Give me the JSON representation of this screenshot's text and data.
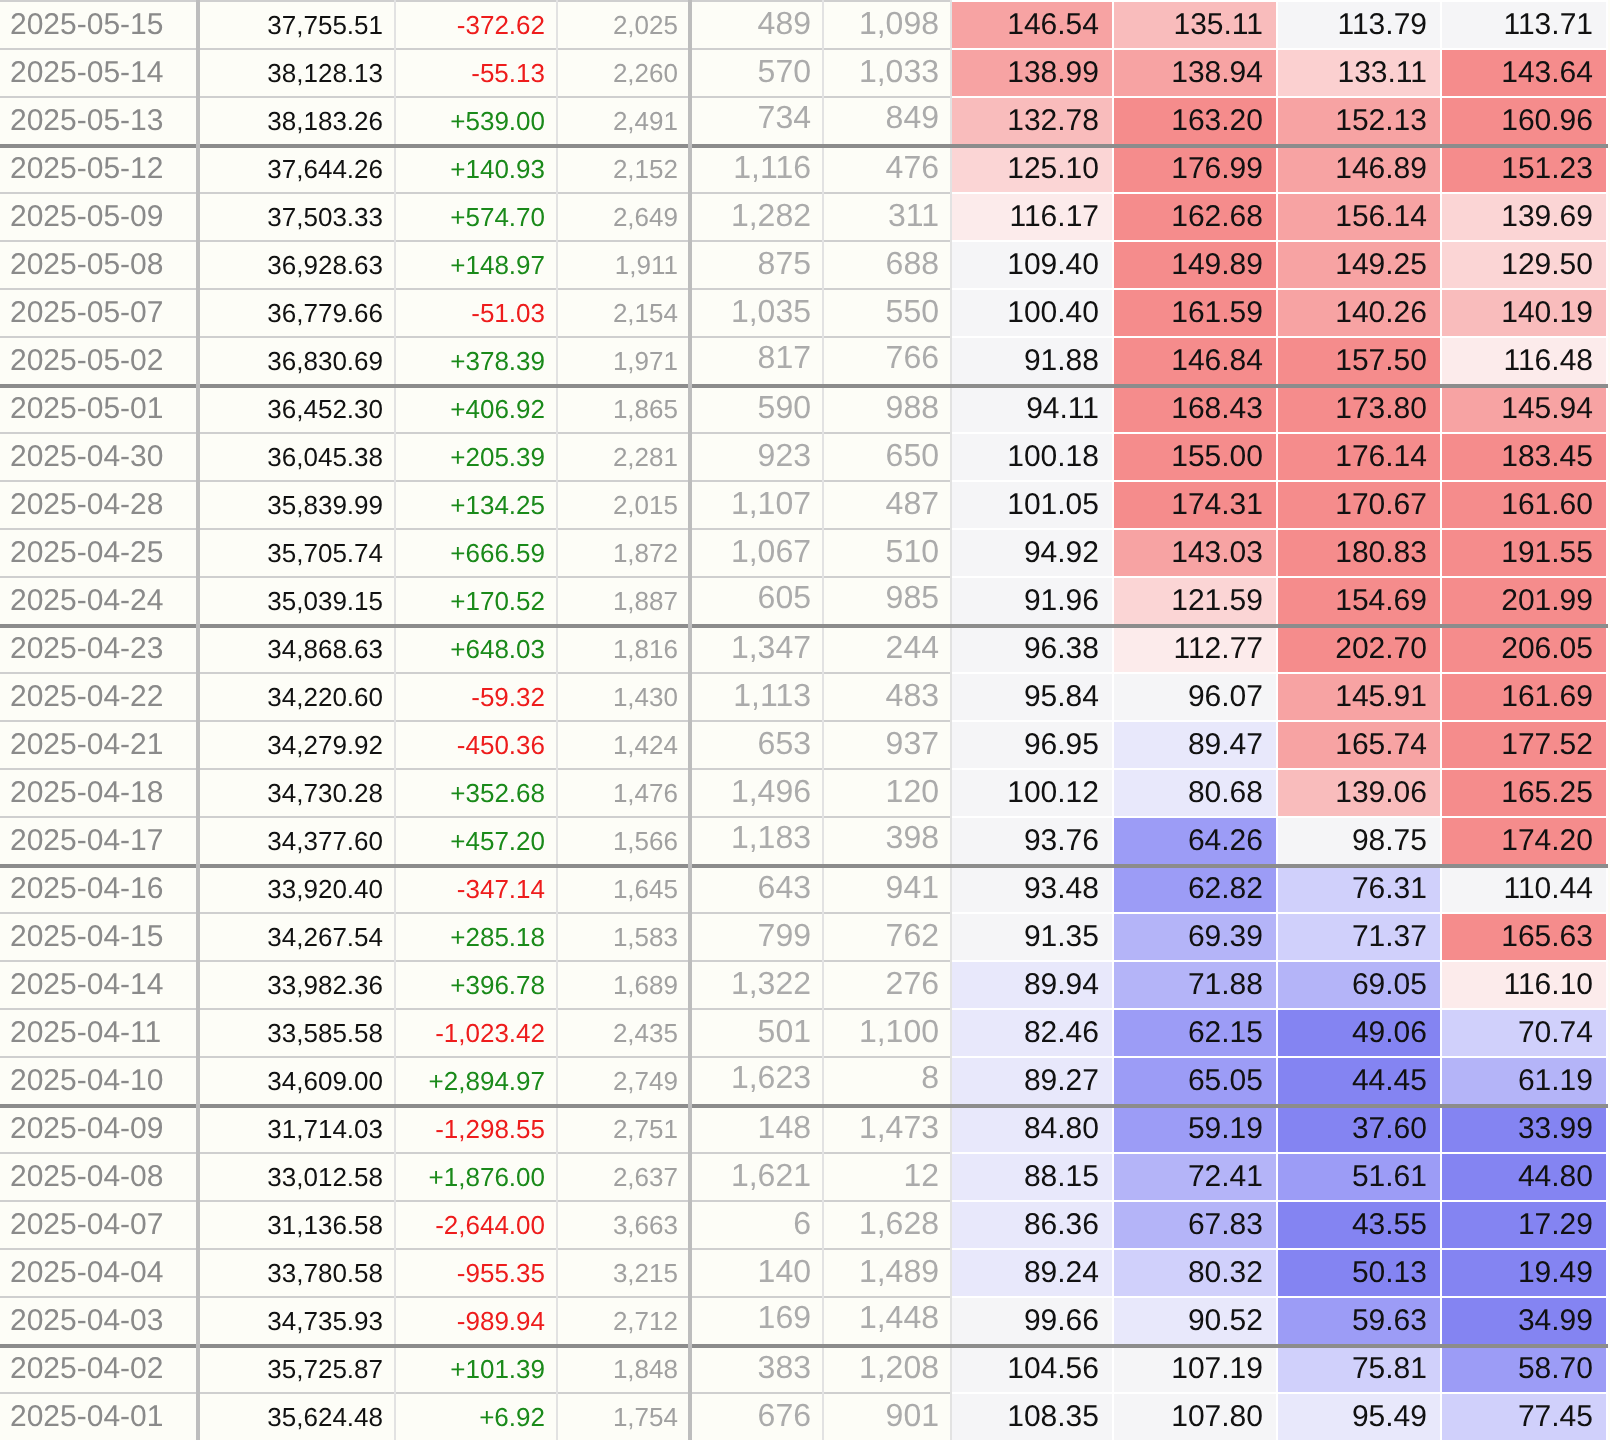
{
  "rows": [
    {
      "group_start": false,
      "date": "2025-05-15",
      "close": "37,755.51",
      "change": "-372.62",
      "negative": true,
      "column_4": "2,025",
      "column_5": "489",
      "column_6": "1,098",
      "heat": [
        {
          "value": "146.54",
          "color": "#f7a3a3"
        },
        {
          "value": "135.11",
          "color": "#f9bcbc"
        },
        {
          "value": "113.79",
          "color": "#f5f5f7"
        },
        {
          "value": "113.71",
          "color": "#f5f5f7"
        }
      ]
    },
    {
      "group_start": false,
      "date": "2025-05-14",
      "close": "38,128.13",
      "change": "-55.13",
      "negative": true,
      "column_4": "2,260",
      "column_5": "570",
      "column_6": "1,033",
      "heat": [
        {
          "value": "138.99",
          "color": "#f7a3a3"
        },
        {
          "value": "138.94",
          "color": "#f7a3a3"
        },
        {
          "value": "133.11",
          "color": "#fbd0d0"
        },
        {
          "value": "143.64",
          "color": "#f58c8c"
        }
      ]
    },
    {
      "group_start": false,
      "date": "2025-05-13",
      "close": "38,183.26",
      "change": "+539.00",
      "negative": false,
      "column_4": "2,491",
      "column_5": "734",
      "column_6": "849",
      "heat": [
        {
          "value": "132.78",
          "color": "#f9bcbc"
        },
        {
          "value": "163.20",
          "color": "#f58c8c"
        },
        {
          "value": "152.13",
          "color": "#f7a3a3"
        },
        {
          "value": "160.96",
          "color": "#f58c8c"
        }
      ]
    },
    {
      "group_start": true,
      "date": "2025-05-12",
      "close": "37,644.26",
      "change": "+140.93",
      "negative": false,
      "column_4": "2,152",
      "column_5": "1,116",
      "column_6": "476",
      "heat": [
        {
          "value": "125.10",
          "color": "#fbd5d5"
        },
        {
          "value": "176.99",
          "color": "#f58c8c"
        },
        {
          "value": "146.89",
          "color": "#f7a3a3"
        },
        {
          "value": "151.23",
          "color": "#f58c8c"
        }
      ]
    },
    {
      "group_start": false,
      "date": "2025-05-09",
      "close": "37,503.33",
      "change": "+574.70",
      "negative": false,
      "column_4": "2,649",
      "column_5": "1,282",
      "column_6": "311",
      "heat": [
        {
          "value": "116.17",
          "color": "#fcebeb"
        },
        {
          "value": "162.68",
          "color": "#f58c8c"
        },
        {
          "value": "156.14",
          "color": "#f7a3a3"
        },
        {
          "value": "139.69",
          "color": "#fbd5d5"
        }
      ]
    },
    {
      "group_start": false,
      "date": "2025-05-08",
      "close": "36,928.63",
      "change": "+148.97",
      "negative": false,
      "column_4": "1,911",
      "column_5": "875",
      "column_6": "688",
      "heat": [
        {
          "value": "109.40",
          "color": "#f5f5f7"
        },
        {
          "value": "149.89",
          "color": "#f58c8c"
        },
        {
          "value": "149.25",
          "color": "#f7a3a3"
        },
        {
          "value": "129.50",
          "color": "#fbd5d5"
        }
      ]
    },
    {
      "group_start": false,
      "date": "2025-05-07",
      "close": "36,779.66",
      "change": "-51.03",
      "negative": true,
      "column_4": "2,154",
      "column_5": "1,035",
      "column_6": "550",
      "heat": [
        {
          "value": "100.40",
          "color": "#f5f5f7"
        },
        {
          "value": "161.59",
          "color": "#f58c8c"
        },
        {
          "value": "140.26",
          "color": "#f7a3a3"
        },
        {
          "value": "140.19",
          "color": "#f9bcbc"
        }
      ]
    },
    {
      "group_start": false,
      "date": "2025-05-02",
      "close": "36,830.69",
      "change": "+378.39",
      "negative": false,
      "column_4": "1,971",
      "column_5": "817",
      "column_6": "766",
      "heat": [
        {
          "value": "91.88",
          "color": "#f5f5f7"
        },
        {
          "value": "146.84",
          "color": "#f58c8c"
        },
        {
          "value": "157.50",
          "color": "#f58c8c"
        },
        {
          "value": "116.48",
          "color": "#fcebeb"
        }
      ]
    },
    {
      "group_start": true,
      "date": "2025-05-01",
      "close": "36,452.30",
      "change": "+406.92",
      "negative": false,
      "column_4": "1,865",
      "column_5": "590",
      "column_6": "988",
      "heat": [
        {
          "value": "94.11",
          "color": "#f5f5f7"
        },
        {
          "value": "168.43",
          "color": "#f58c8c"
        },
        {
          "value": "173.80",
          "color": "#f58c8c"
        },
        {
          "value": "145.94",
          "color": "#f7a3a3"
        }
      ]
    },
    {
      "group_start": false,
      "date": "2025-04-30",
      "close": "36,045.38",
      "change": "+205.39",
      "negative": false,
      "column_4": "2,281",
      "column_5": "923",
      "column_6": "650",
      "heat": [
        {
          "value": "100.18",
          "color": "#f5f5f7"
        },
        {
          "value": "155.00",
          "color": "#f58c8c"
        },
        {
          "value": "176.14",
          "color": "#f58c8c"
        },
        {
          "value": "183.45",
          "color": "#f58c8c"
        }
      ]
    },
    {
      "group_start": false,
      "date": "2025-04-28",
      "close": "35,839.99",
      "change": "+134.25",
      "negative": false,
      "column_4": "2,015",
      "column_5": "1,107",
      "column_6": "487",
      "heat": [
        {
          "value": "101.05",
          "color": "#f5f5f7"
        },
        {
          "value": "174.31",
          "color": "#f58c8c"
        },
        {
          "value": "170.67",
          "color": "#f58c8c"
        },
        {
          "value": "161.60",
          "color": "#f58c8c"
        }
      ]
    },
    {
      "group_start": false,
      "date": "2025-04-25",
      "close": "35,705.74",
      "change": "+666.59",
      "negative": false,
      "column_4": "1,872",
      "column_5": "1,067",
      "column_6": "510",
      "heat": [
        {
          "value": "94.92",
          "color": "#f5f5f7"
        },
        {
          "value": "143.03",
          "color": "#f7a3a3"
        },
        {
          "value": "180.83",
          "color": "#f58c8c"
        },
        {
          "value": "191.55",
          "color": "#f58c8c"
        }
      ]
    },
    {
      "group_start": false,
      "date": "2025-04-24",
      "close": "35,039.15",
      "change": "+170.52",
      "negative": false,
      "column_4": "1,887",
      "column_5": "605",
      "column_6": "985",
      "heat": [
        {
          "value": "91.96",
          "color": "#f5f5f7"
        },
        {
          "value": "121.59",
          "color": "#fbd5d5"
        },
        {
          "value": "154.69",
          "color": "#f58c8c"
        },
        {
          "value": "201.99",
          "color": "#f58c8c"
        }
      ]
    },
    {
      "group_start": true,
      "date": "2025-04-23",
      "close": "34,868.63",
      "change": "+648.03",
      "negative": false,
      "column_4": "1,816",
      "column_5": "1,347",
      "column_6": "244",
      "heat": [
        {
          "value": "96.38",
          "color": "#f5f5f7"
        },
        {
          "value": "112.77",
          "color": "#fcebeb"
        },
        {
          "value": "202.70",
          "color": "#f58c8c"
        },
        {
          "value": "206.05",
          "color": "#f58c8c"
        }
      ]
    },
    {
      "group_start": false,
      "date": "2025-04-22",
      "close": "34,220.60",
      "change": "-59.32",
      "negative": true,
      "column_4": "1,430",
      "column_5": "1,113",
      "column_6": "483",
      "heat": [
        {
          "value": "95.84",
          "color": "#f5f5f7"
        },
        {
          "value": "96.07",
          "color": "#f5f5f7"
        },
        {
          "value": "145.91",
          "color": "#f7a3a3"
        },
        {
          "value": "161.69",
          "color": "#f58c8c"
        }
      ]
    },
    {
      "group_start": false,
      "date": "2025-04-21",
      "close": "34,279.92",
      "change": "-450.36",
      "negative": true,
      "column_4": "1,424",
      "column_5": "653",
      "column_6": "937",
      "heat": [
        {
          "value": "96.95",
          "color": "#f5f5f7"
        },
        {
          "value": "89.47",
          "color": "#e8e8fb"
        },
        {
          "value": "165.74",
          "color": "#f7a3a3"
        },
        {
          "value": "177.52",
          "color": "#f58c8c"
        }
      ]
    },
    {
      "group_start": false,
      "date": "2025-04-18",
      "close": "34,730.28",
      "change": "+352.68",
      "negative": false,
      "column_4": "1,476",
      "column_5": "1,496",
      "column_6": "120",
      "heat": [
        {
          "value": "100.12",
          "color": "#f5f5f7"
        },
        {
          "value": "80.68",
          "color": "#e8e8fb"
        },
        {
          "value": "139.06",
          "color": "#f9bcbc"
        },
        {
          "value": "165.25",
          "color": "#f58c8c"
        }
      ]
    },
    {
      "group_start": false,
      "date": "2025-04-17",
      "close": "34,377.60",
      "change": "+457.20",
      "negative": false,
      "column_4": "1,566",
      "column_5": "1,183",
      "column_6": "398",
      "heat": [
        {
          "value": "93.76",
          "color": "#f5f5f7"
        },
        {
          "value": "64.26",
          "color": "#9c9cf6"
        },
        {
          "value": "98.75",
          "color": "#f5f5f7"
        },
        {
          "value": "174.20",
          "color": "#f58c8c"
        }
      ]
    },
    {
      "group_start": true,
      "date": "2025-04-16",
      "close": "33,920.40",
      "change": "-347.14",
      "negative": true,
      "column_4": "1,645",
      "column_5": "643",
      "column_6": "941",
      "heat": [
        {
          "value": "93.48",
          "color": "#f5f5f7"
        },
        {
          "value": "62.82",
          "color": "#9c9cf6"
        },
        {
          "value": "76.31",
          "color": "#d0d0fb"
        },
        {
          "value": "110.44",
          "color": "#f5f5f7"
        }
      ]
    },
    {
      "group_start": false,
      "date": "2025-04-15",
      "close": "34,267.54",
      "change": "+285.18",
      "negative": false,
      "column_4": "1,583",
      "column_5": "799",
      "column_6": "762",
      "heat": [
        {
          "value": "91.35",
          "color": "#f5f5f7"
        },
        {
          "value": "69.39",
          "color": "#b4b4f8"
        },
        {
          "value": "71.37",
          "color": "#d0d0fb"
        },
        {
          "value": "165.63",
          "color": "#f58c8c"
        }
      ]
    },
    {
      "group_start": false,
      "date": "2025-04-14",
      "close": "33,982.36",
      "change": "+396.78",
      "negative": false,
      "column_4": "1,689",
      "column_5": "1,322",
      "column_6": "276",
      "heat": [
        {
          "value": "89.94",
          "color": "#e8e8fb"
        },
        {
          "value": "71.88",
          "color": "#b4b4f8"
        },
        {
          "value": "69.05",
          "color": "#b4b4f8"
        },
        {
          "value": "116.10",
          "color": "#fcebeb"
        }
      ]
    },
    {
      "group_start": false,
      "date": "2025-04-11",
      "close": "33,585.58",
      "change": "-1,023.42",
      "negative": true,
      "column_4": "2,435",
      "column_5": "501",
      "column_6": "1,100",
      "heat": [
        {
          "value": "82.46",
          "color": "#e8e8fb"
        },
        {
          "value": "62.15",
          "color": "#9c9cf6"
        },
        {
          "value": "49.06",
          "color": "#8484f2"
        },
        {
          "value": "70.74",
          "color": "#d0d0fb"
        }
      ]
    },
    {
      "group_start": false,
      "date": "2025-04-10",
      "close": "34,609.00",
      "change": "+2,894.97",
      "negative": false,
      "column_4": "2,749",
      "column_5": "1,623",
      "column_6": "8",
      "heat": [
        {
          "value": "89.27",
          "color": "#e8e8fb"
        },
        {
          "value": "65.05",
          "color": "#9c9cf6"
        },
        {
          "value": "44.45",
          "color": "#8484f2"
        },
        {
          "value": "61.19",
          "color": "#b4b4f8"
        }
      ]
    },
    {
      "group_start": true,
      "date": "2025-04-09",
      "close": "31,714.03",
      "change": "-1,298.55",
      "negative": true,
      "column_4": "2,751",
      "column_5": "148",
      "column_6": "1,473",
      "heat": [
        {
          "value": "84.80",
          "color": "#e8e8fb"
        },
        {
          "value": "59.19",
          "color": "#9c9cf6"
        },
        {
          "value": "37.60",
          "color": "#8484f2"
        },
        {
          "value": "33.99",
          "color": "#8484f2"
        }
      ]
    },
    {
      "group_start": false,
      "date": "2025-04-08",
      "close": "33,012.58",
      "change": "+1,876.00",
      "negative": false,
      "column_4": "2,637",
      "column_5": "1,621",
      "column_6": "12",
      "heat": [
        {
          "value": "88.15",
          "color": "#e8e8fb"
        },
        {
          "value": "72.41",
          "color": "#b4b4f8"
        },
        {
          "value": "51.61",
          "color": "#9c9cf6"
        },
        {
          "value": "44.80",
          "color": "#8484f2"
        }
      ]
    },
    {
      "group_start": false,
      "date": "2025-04-07",
      "close": "31,136.58",
      "change": "-2,644.00",
      "negative": true,
      "column_4": "3,663",
      "column_5": "6",
      "column_6": "1,628",
      "heat": [
        {
          "value": "86.36",
          "color": "#e8e8fb"
        },
        {
          "value": "67.83",
          "color": "#b4b4f8"
        },
        {
          "value": "43.55",
          "color": "#8484f2"
        },
        {
          "value": "17.29",
          "color": "#8484f2"
        }
      ]
    },
    {
      "group_start": false,
      "date": "2025-04-04",
      "close": "33,780.58",
      "change": "-955.35",
      "negative": true,
      "column_4": "3,215",
      "column_5": "140",
      "column_6": "1,489",
      "heat": [
        {
          "value": "89.24",
          "color": "#e8e8fb"
        },
        {
          "value": "80.32",
          "color": "#d0d0fb"
        },
        {
          "value": "50.13",
          "color": "#8484f2"
        },
        {
          "value": "19.49",
          "color": "#8484f2"
        }
      ]
    },
    {
      "group_start": false,
      "date": "2025-04-03",
      "close": "34,735.93",
      "change": "-989.94",
      "negative": true,
      "column_4": "2,712",
      "column_5": "169",
      "column_6": "1,448",
      "heat": [
        {
          "value": "99.66",
          "color": "#f5f5f7"
        },
        {
          "value": "90.52",
          "color": "#e8e8fb"
        },
        {
          "value": "59.63",
          "color": "#9c9cf6"
        },
        {
          "value": "34.99",
          "color": "#8484f2"
        }
      ]
    },
    {
      "group_start": true,
      "date": "2025-04-02",
      "close": "35,725.87",
      "change": "+101.39",
      "negative": false,
      "column_4": "1,848",
      "column_5": "383",
      "column_6": "1,208",
      "heat": [
        {
          "value": "104.56",
          "color": "#f5f5f7"
        },
        {
          "value": "107.19",
          "color": "#f5f5f7"
        },
        {
          "value": "75.81",
          "color": "#d0d0fb"
        },
        {
          "value": "58.70",
          "color": "#9c9cf6"
        }
      ]
    },
    {
      "group_start": false,
      "date": "2025-04-01",
      "close": "35,624.48",
      "change": "+6.92",
      "negative": false,
      "column_4": "1,754",
      "column_5": "676",
      "column_6": "901",
      "heat": [
        {
          "value": "108.35",
          "color": "#f5f5f7"
        },
        {
          "value": "107.80",
          "color": "#f5f5f7"
        },
        {
          "value": "95.49",
          "color": "#e8e8fb"
        },
        {
          "value": "77.45",
          "color": "#d0d0fb"
        }
      ]
    }
  ]
}
